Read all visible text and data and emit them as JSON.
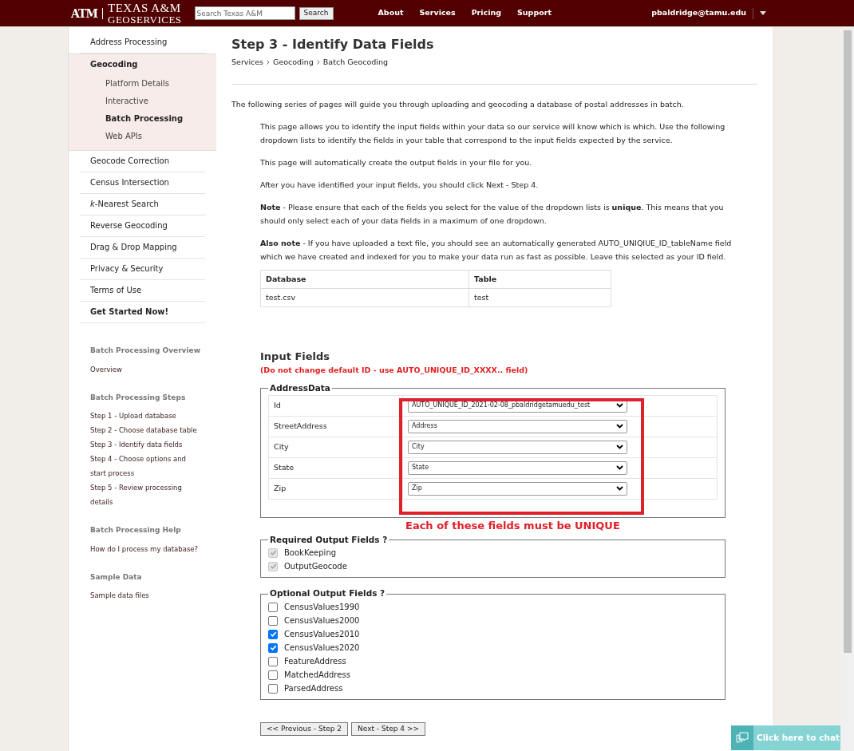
{
  "header": {
    "logo_mark": "ATM",
    "logo_line1": "TEXAS A&M",
    "logo_line2": "GEOSERVICES",
    "search": {
      "placeholder": "Search Texas A&M",
      "button": "Search"
    },
    "nav": [
      "About",
      "Services",
      "Pricing",
      "Support"
    ],
    "user": "pbaldridge@tamu.edu"
  },
  "sidebar": {
    "items": [
      {
        "label": "Address Processing",
        "kind": "link",
        "expanded": false
      },
      {
        "label": "Geocoding",
        "kind": "link",
        "expanded": true,
        "children": [
          {
            "label": "Platform Details",
            "selected": false
          },
          {
            "label": "Interactive",
            "selected": false
          },
          {
            "label": "Batch Processing",
            "selected": true
          },
          {
            "label": "Web APIs",
            "selected": false
          }
        ]
      },
      {
        "label": "Geocode Correction",
        "kind": "link",
        "expanded": false
      },
      {
        "label": "Census Intersection",
        "kind": "link",
        "expanded": false
      },
      {
        "label": "*k*-Nearest Search",
        "kind": "link",
        "expanded": false
      },
      {
        "label": "Reverse Geocoding",
        "kind": "link",
        "expanded": false
      },
      {
        "label": "Drag & Drop Mapping",
        "kind": "link",
        "expanded": false
      },
      {
        "label": "Privacy & Security",
        "kind": "link",
        "expanded": false
      },
      {
        "label": "Terms of Use",
        "kind": "link",
        "expanded": false
      },
      {
        "label": "Get Started Now!",
        "kind": "cta",
        "expanded": false
      }
    ],
    "sections": [
      {
        "title": "Batch Processing Overview",
        "links": [
          "Overview"
        ]
      },
      {
        "title": "Batch Processing Steps",
        "links": [
          "Step 1 - Upload database",
          "Step 2 - Choose database table",
          "Step 3 - Identify data fields",
          "Step 4 - Choose options and start process",
          "Step 5 - Review processing details"
        ]
      },
      {
        "title": "Batch Processing Help",
        "links": [
          "How do I process my database?"
        ]
      },
      {
        "title": "Sample Data",
        "links": [
          "Sample data files"
        ]
      }
    ]
  },
  "page": {
    "title": "Step 3 - Identify Data Fields",
    "breadcrumb": [
      "Services",
      "Geocoding",
      "Batch Geocoding"
    ],
    "intro": "The following series of pages will guide you through uploading and geocoding a database of postal addresses in batch.",
    "paragraphs": [
      "This page allows you to identify the input fields within your data so our service will know which is which. Use the following dropdown lists to identify the fields in your table that correspond to the input fields expected by the service.",
      "This page will automatically create the output fields in your file for you.",
      "After you have identified your input fields, you should click Next - Step 4.",
      "**Note** - Please ensure that each of the fields you select for the value of the dropdown lists is **unique**. This means that you should only select each of your data fields in a maximum of one dropdown.",
      "**Also note** - If you have uploaded a text file, you should see an automatically generated AUTO_UNIQIUE_ID_tableName field which we have created and indexed for you to make your data run as fast as possible. Leave this selected as your ID field."
    ],
    "table": {
      "columns": [
        "Database",
        "Table"
      ],
      "rows": [
        [
          "test.csv",
          "test"
        ]
      ]
    },
    "input_fields": {
      "title": "Input Fields",
      "warning": "(Do not change default ID - use AUTO_UNIQUE_ID_XXXX.. field)",
      "legend": "AddressData",
      "rows": [
        {
          "label": "Id",
          "value": "AUTO_UNIQUE_ID_2021-02-08_pbaldridgetamuedu_test"
        },
        {
          "label": "StreetAddress",
          "value": "Address"
        },
        {
          "label": "City",
          "value": "City"
        },
        {
          "label": "State",
          "value": "State"
        },
        {
          "label": "Zip",
          "value": "Zip"
        }
      ],
      "annotation": "Each of these fields must be UNIQUE"
    },
    "required_output": {
      "legend": "Required Output Fields ?",
      "fields": [
        {
          "label": "BookKeeping",
          "checked": true,
          "disabled": true
        },
        {
          "label": "OutputGeocode",
          "checked": true,
          "disabled": true
        }
      ]
    },
    "optional_output": {
      "legend": "Optional Output Fields ?",
      "fields": [
        {
          "label": "CensusValues1990",
          "checked": false,
          "disabled": false
        },
        {
          "label": "CensusValues2000",
          "checked": false,
          "disabled": false
        },
        {
          "label": "CensusValues2010",
          "checked": true,
          "disabled": false
        },
        {
          "label": "CensusValues2020",
          "checked": true,
          "disabled": false
        },
        {
          "label": "FeatureAddress",
          "checked": false,
          "disabled": false
        },
        {
          "label": "MatchedAddress",
          "checked": false,
          "disabled": false
        },
        {
          "label": "ParsedAddress",
          "checked": false,
          "disabled": false
        }
      ]
    },
    "buttons": [
      "<< Previous - Step 2",
      "Next - Step 4 >>"
    ]
  },
  "chat": {
    "label": "Click here to chat"
  }
}
